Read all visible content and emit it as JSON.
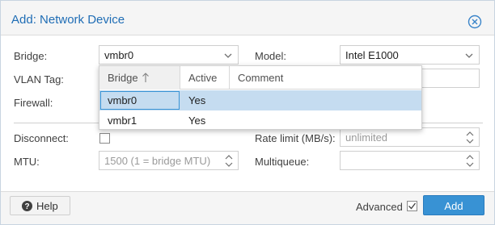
{
  "dialog": {
    "title": "Add: Network Device",
    "icons": {
      "close": "close-circle-icon"
    }
  },
  "form": {
    "bridge": {
      "label": "Bridge:",
      "value": "vmbr0"
    },
    "vlan_tag": {
      "label": "VLAN Tag:"
    },
    "firewall": {
      "label": "Firewall:"
    },
    "model": {
      "label": "Model:",
      "value": "Intel E1000"
    },
    "disconnect": {
      "label": "Disconnect:",
      "checked": false
    },
    "mtu": {
      "label": "MTU:",
      "placeholder": "1500 (1 = bridge MTU)"
    },
    "rate_limit": {
      "label": "Rate limit (MB/s):",
      "placeholder": "unlimited"
    },
    "multiqueue": {
      "label": "Multiqueue:",
      "value": ""
    }
  },
  "bridge_picker": {
    "columns": [
      "Bridge",
      "Active",
      "Comment"
    ],
    "sort_icon": "sort-ascending-icon",
    "rows": [
      {
        "bridge": "vmbr0",
        "active": "Yes",
        "comment": "",
        "selected": true
      },
      {
        "bridge": "vmbr1",
        "active": "Yes",
        "comment": "",
        "selected": false
      }
    ]
  },
  "footer": {
    "help_label": "Help",
    "help_icon": "question-circle-icon",
    "advanced_label": "Advanced",
    "advanced_checked": true,
    "add_label": "Add"
  },
  "colors": {
    "title": "#1f6db5",
    "primary_button": "#3892d4",
    "selected_row": "#c5dcf0"
  }
}
